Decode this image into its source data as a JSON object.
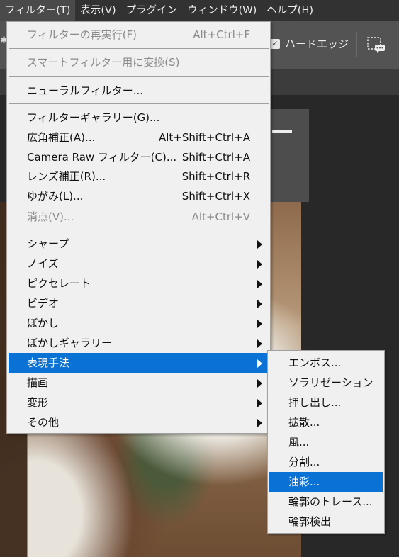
{
  "menubar": {
    "items": [
      "フィルター(T)",
      "表示(V)",
      "プラグイン",
      "ウィンドウ(W)",
      "ヘルプ(H)"
    ]
  },
  "options_bar": {
    "hard_edge_label": "ハードエッジ",
    "hard_edge_checked": true
  },
  "filter_menu": {
    "repeat": {
      "label": "フィルターの再実行(F)",
      "shortcut": "Alt+Ctrl+F",
      "enabled": false
    },
    "smart_convert": {
      "label": "スマートフィルター用に変換(S)",
      "enabled": false
    },
    "neural": {
      "label": "ニューラルフィルター..."
    },
    "gallery": {
      "label": "フィルターギャラリー(G)..."
    },
    "adaptive_wide_angle": {
      "label": "広角補正(A)...",
      "shortcut": "Alt+Shift+Ctrl+A"
    },
    "camera_raw": {
      "label": "Camera Raw フィルター(C)...",
      "shortcut": "Shift+Ctrl+A"
    },
    "lens_correction": {
      "label": "レンズ補正(R)...",
      "shortcut": "Shift+Ctrl+R"
    },
    "liquify": {
      "label": "ゆがみ(L)...",
      "shortcut": "Shift+Ctrl+X"
    },
    "vanishing_point": {
      "label": "消点(V)...",
      "shortcut": "Alt+Ctrl+V",
      "enabled": false
    },
    "submenus": [
      "シャープ",
      "ノイズ",
      "ピクセレート",
      "ビデオ",
      "ぼかし",
      "ぼかしギャラリー",
      "表現手法",
      "描画",
      "変形",
      "その他"
    ],
    "highlighted": "表現手法"
  },
  "stylize_submenu": {
    "items": [
      "エンボス...",
      "ソラリゼーション",
      "押し出し...",
      "拡散...",
      "風...",
      "分割...",
      "油彩...",
      "輪郭のトレース...",
      "輪郭検出"
    ],
    "highlighted": "油彩..."
  }
}
